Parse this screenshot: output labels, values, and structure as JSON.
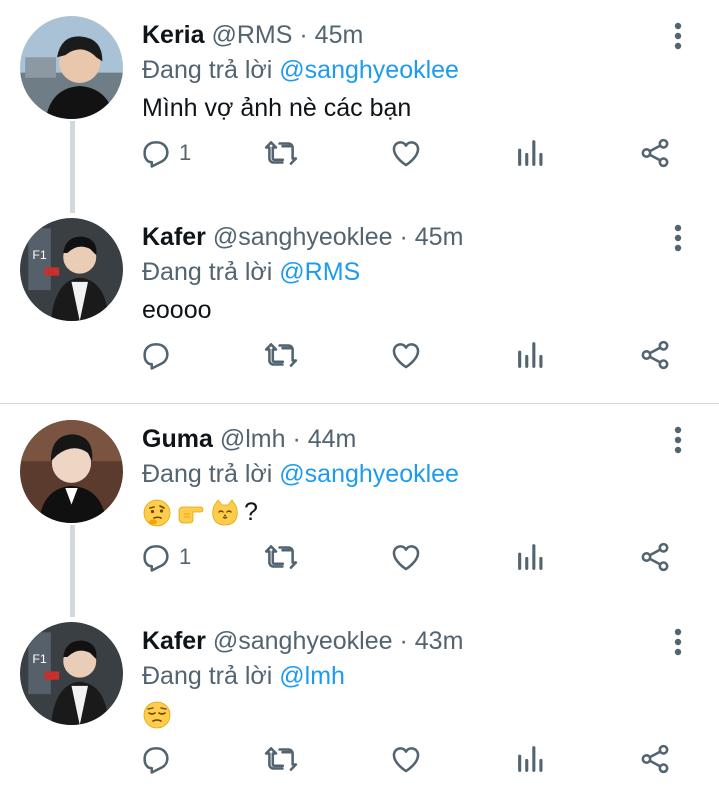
{
  "tweets": [
    {
      "name": "Keria",
      "handle": "@RMS",
      "time": "45m",
      "reply_prefix": "Đang trả lời",
      "reply_to": "@sanghyeoklee",
      "text": "Mình vợ ảnh nè các bạn",
      "reply_count": "1",
      "avatar": "avatar-photo"
    },
    {
      "name": "Kafer",
      "handle": "@sanghyeoklee",
      "time": "45m",
      "reply_prefix": "Đang trả lời",
      "reply_to": "@RMS",
      "text": "eoooo",
      "reply_count": "",
      "avatar": "avatar-photo"
    },
    {
      "name": "Guma",
      "handle": "@lmh",
      "time": "44m",
      "reply_prefix": "Đang trả lời",
      "reply_to": "@sanghyeoklee",
      "text": "?",
      "emojis": [
        "thinking-face-emoji",
        "pointing-right-emoji",
        "cat-face-emoji"
      ],
      "reply_count": "1",
      "avatar": "avatar-photo"
    },
    {
      "name": "Kafer",
      "handle": "@sanghyeoklee",
      "time": "43m",
      "reply_prefix": "Đang trả lời",
      "reply_to": "@lmh",
      "text": "",
      "emojis": [
        "pensive-face-emoji"
      ],
      "reply_count": "",
      "avatar": "avatar-photo"
    }
  ],
  "separator": "·",
  "colors": {
    "accent": "#1d9bf0",
    "muted": "#536471",
    "line": "#cfd9de"
  }
}
